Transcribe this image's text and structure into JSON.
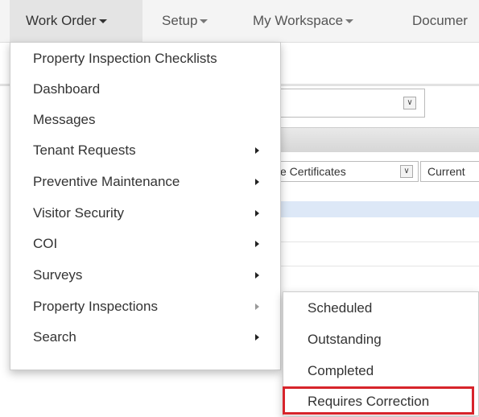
{
  "nav": {
    "items": [
      {
        "label": "Work Order"
      },
      {
        "label": "Setup"
      },
      {
        "label": "My Workspace"
      },
      {
        "label": "Documer"
      }
    ]
  },
  "background": {
    "filter1": "ve Certificates",
    "filter2": "Current"
  },
  "work_order_menu": {
    "items": [
      {
        "label": "Property Inspection Checklists",
        "has_submenu": false
      },
      {
        "label": "Dashboard",
        "has_submenu": false
      },
      {
        "label": "Messages",
        "has_submenu": false
      },
      {
        "label": "Tenant Requests",
        "has_submenu": true
      },
      {
        "label": "Preventive Maintenance",
        "has_submenu": true
      },
      {
        "label": "Visitor Security",
        "has_submenu": true
      },
      {
        "label": "COI",
        "has_submenu": true
      },
      {
        "label": "Surveys",
        "has_submenu": true
      },
      {
        "label": "Property Inspections",
        "has_submenu": true
      },
      {
        "label": "Search",
        "has_submenu": true
      }
    ]
  },
  "inspections_submenu": {
    "items": [
      {
        "label": "Scheduled"
      },
      {
        "label": "Outstanding"
      },
      {
        "label": "Completed"
      },
      {
        "label": "Requires Correction"
      }
    ],
    "highlight_color": "#d7242b"
  }
}
